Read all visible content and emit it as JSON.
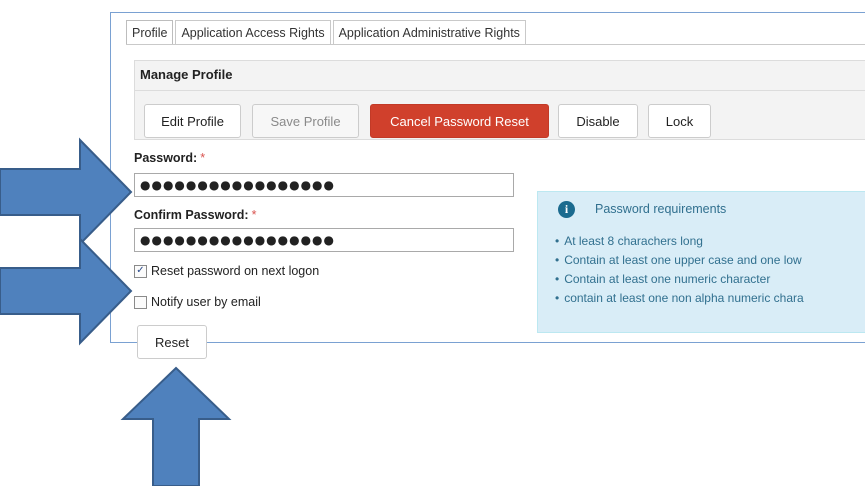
{
  "tabs": [
    {
      "label": "Profile"
    },
    {
      "label": "Application Access Rights"
    },
    {
      "label": "Application Administrative Rights"
    }
  ],
  "manage": {
    "title": "Manage Profile",
    "buttons": {
      "edit": "Edit Profile",
      "save": "Save Profile",
      "cancel_reset": "Cancel Password Reset",
      "disable": "Disable",
      "lock": "Lock"
    }
  },
  "form": {
    "password_label": "Password:",
    "password_value": "●●●●●●●●●●●●●●●●●",
    "confirm_label": "Confirm Password:",
    "confirm_value": "●●●●●●●●●●●●●●●●●",
    "required_mark": "*",
    "reset_on_logon": {
      "label": "Reset password on next logon",
      "checked": true,
      "mark": "✓"
    },
    "notify_email": {
      "label": "Notify user by email",
      "checked": false
    },
    "reset_button": "Reset"
  },
  "requirements": {
    "icon_glyph": "i",
    "title": "Password requirements",
    "items": [
      "At least 8 charachers long",
      "Contain at least one upper case and one low",
      "Contain at least one numeric character",
      "contain at least one non alpha numeric chara"
    ],
    "bullet": "•"
  },
  "colors": {
    "accent_border": "#7aa1d2",
    "danger": "#d0402c",
    "info_bg": "#d9edf7",
    "info_text": "#31708f",
    "arrow_fill": "#4f81bd",
    "arrow_stroke": "#385d8a"
  }
}
